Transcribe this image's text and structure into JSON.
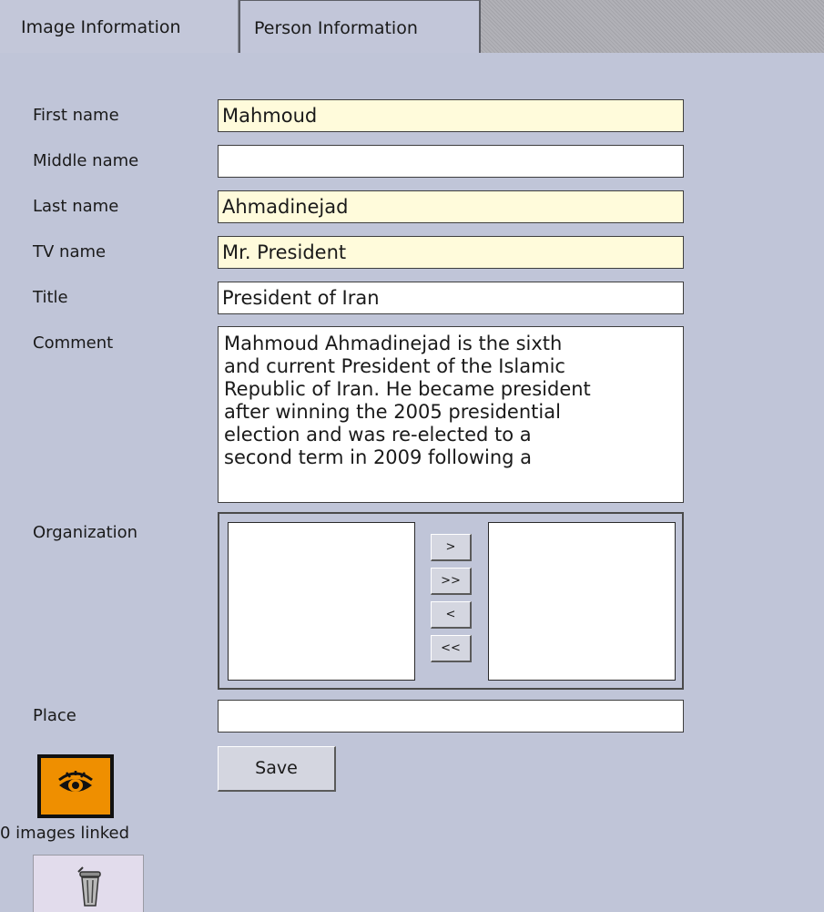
{
  "tabs": {
    "image": "Image Information",
    "person": "Person Information"
  },
  "labels": {
    "first_name": "First name",
    "middle_name": "Middle name",
    "last_name": "Last name",
    "tv_name": "TV name",
    "title": "Title",
    "comment": "Comment",
    "organization": "Organization",
    "place": "Place"
  },
  "values": {
    "first_name": "Mahmoud",
    "middle_name": "",
    "last_name": "Ahmadinejad",
    "tv_name": "Mr. President",
    "title": "President of Iran",
    "comment": "Mahmoud Ahmadinejad is the sixth\nand current President of the Islamic\nRepublic of Iran. He became president\nafter winning the 2005 presidential\nelection and was re-elected to a\nsecond term in 2009 following a",
    "place": ""
  },
  "organization": {
    "move_one_right": ">",
    "move_all_right": ">>",
    "move_one_left": "<",
    "move_all_left": "<<"
  },
  "actions": {
    "save": "Save"
  },
  "status": {
    "images_linked": "0 images linked"
  },
  "icons": {
    "view": "eye-icon",
    "delete": "trash-icon"
  },
  "colors": {
    "panel_background": "#c0c5d8",
    "required_field": "#fffbdb",
    "view_button": "#ef8f00",
    "delete_button": "#e2dcec"
  }
}
